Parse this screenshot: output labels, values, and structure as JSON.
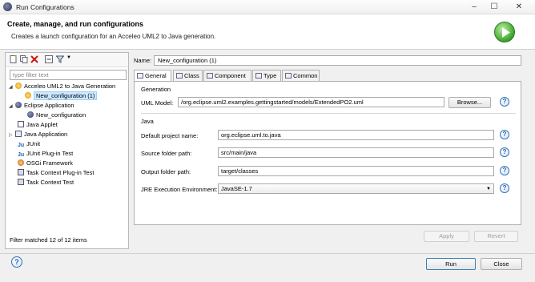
{
  "window": {
    "title": "Run Configurations",
    "minimize": "–",
    "maximize": "☐",
    "close": "✕"
  },
  "header": {
    "title": "Create, manage, and run configurations",
    "subtitle": "Creates a launch configuration for an Acceleo UML2 to Java generation."
  },
  "left": {
    "filter_placeholder": "type filter text",
    "tree": [
      {
        "label": "Acceleo UML2 to Java Generation",
        "expander": "◢",
        "icon": "acceleo-icon"
      },
      {
        "label": "New_configuration (1)",
        "icon": "acceleo-config-icon",
        "selected": true
      },
      {
        "label": "Eclipse Application",
        "expander": "◢",
        "icon": "eclipse-icon"
      },
      {
        "label": "New_configuration",
        "icon": "eclipse-config-icon"
      },
      {
        "label": "Java Applet",
        "icon": "java-applet-icon"
      },
      {
        "label": "Java Application",
        "expander": "▷",
        "icon": "java-app-icon"
      },
      {
        "label": "JUnit",
        "icon": "junit-icon"
      },
      {
        "label": "JUnit Plug-in Test",
        "icon": "junit-plugin-icon"
      },
      {
        "label": "OSGi Framework",
        "icon": "osgi-icon"
      },
      {
        "label": "Task Context Plug-in Test",
        "icon": "task-plugin-icon"
      },
      {
        "label": "Task Context Test",
        "icon": "task-test-icon"
      }
    ],
    "status": "Filter matched 12 of 12 items"
  },
  "right": {
    "name_label": "Name:",
    "name_value": "New_configuration (1)",
    "tabs": [
      {
        "label": "General",
        "active": true
      },
      {
        "label": "Class"
      },
      {
        "label": "Component"
      },
      {
        "label": "Type"
      },
      {
        "label": "Common"
      }
    ],
    "generation": {
      "group": "Generation",
      "uml_label": "UML Model:",
      "uml_value": "/org.eclipse.uml2.examples.gettingstarted/models/ExtendedPO2.uml",
      "browse": "Browse..."
    },
    "java": {
      "group": "Java",
      "fields": [
        {
          "label": "Default project name:",
          "value": "org.eclipse.uml.to.java"
        },
        {
          "label": "Source folder path:",
          "value": "src/main/java"
        },
        {
          "label": "Output folder path:",
          "value": "target/classes"
        },
        {
          "label": "JRE Execution Environment:",
          "value": "JavaSE-1.7"
        }
      ]
    },
    "apply": "Apply",
    "revert": "Revert"
  },
  "footer": {
    "help": "?",
    "run": "Run",
    "close": "Close"
  },
  "help_glyph": "?",
  "colors": {
    "selection": "#cce8ff",
    "run_green": "#3ba32a"
  }
}
